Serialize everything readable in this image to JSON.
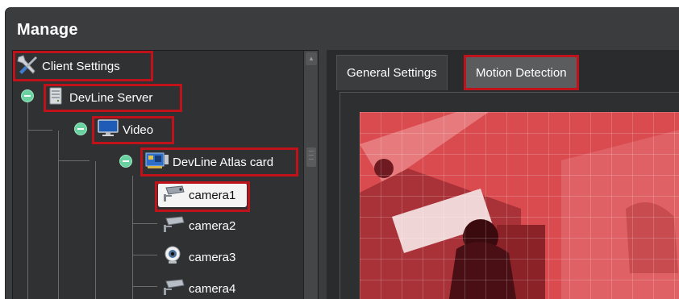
{
  "window": {
    "title": "Manage"
  },
  "tree": {
    "root": {
      "label": "Client Settings",
      "icon": "tools-icon"
    },
    "server": {
      "label": "DevLine Server",
      "icon": "server-icon"
    },
    "video": {
      "label": "Video",
      "icon": "monitor-icon"
    },
    "card": {
      "label": "DevLine Atlas card",
      "icon": "capture-card-icon"
    },
    "cameras": [
      {
        "label": "camera1",
        "icon": "cctv-camera-icon",
        "selected": true
      },
      {
        "label": "camera2",
        "icon": "cctv-camera-icon",
        "selected": false
      },
      {
        "label": "camera3",
        "icon": "webcam-icon",
        "selected": false
      },
      {
        "label": "camera4",
        "icon": "cctv-camera-icon",
        "selected": false
      }
    ]
  },
  "tabs": [
    {
      "label": "General Settings",
      "active": false
    },
    {
      "label": "Motion Detection",
      "active": true
    }
  ],
  "colors": {
    "highlight": "#c0121b",
    "motion_overlay": "#d84a4e",
    "toggle": "#6ad1a0"
  }
}
